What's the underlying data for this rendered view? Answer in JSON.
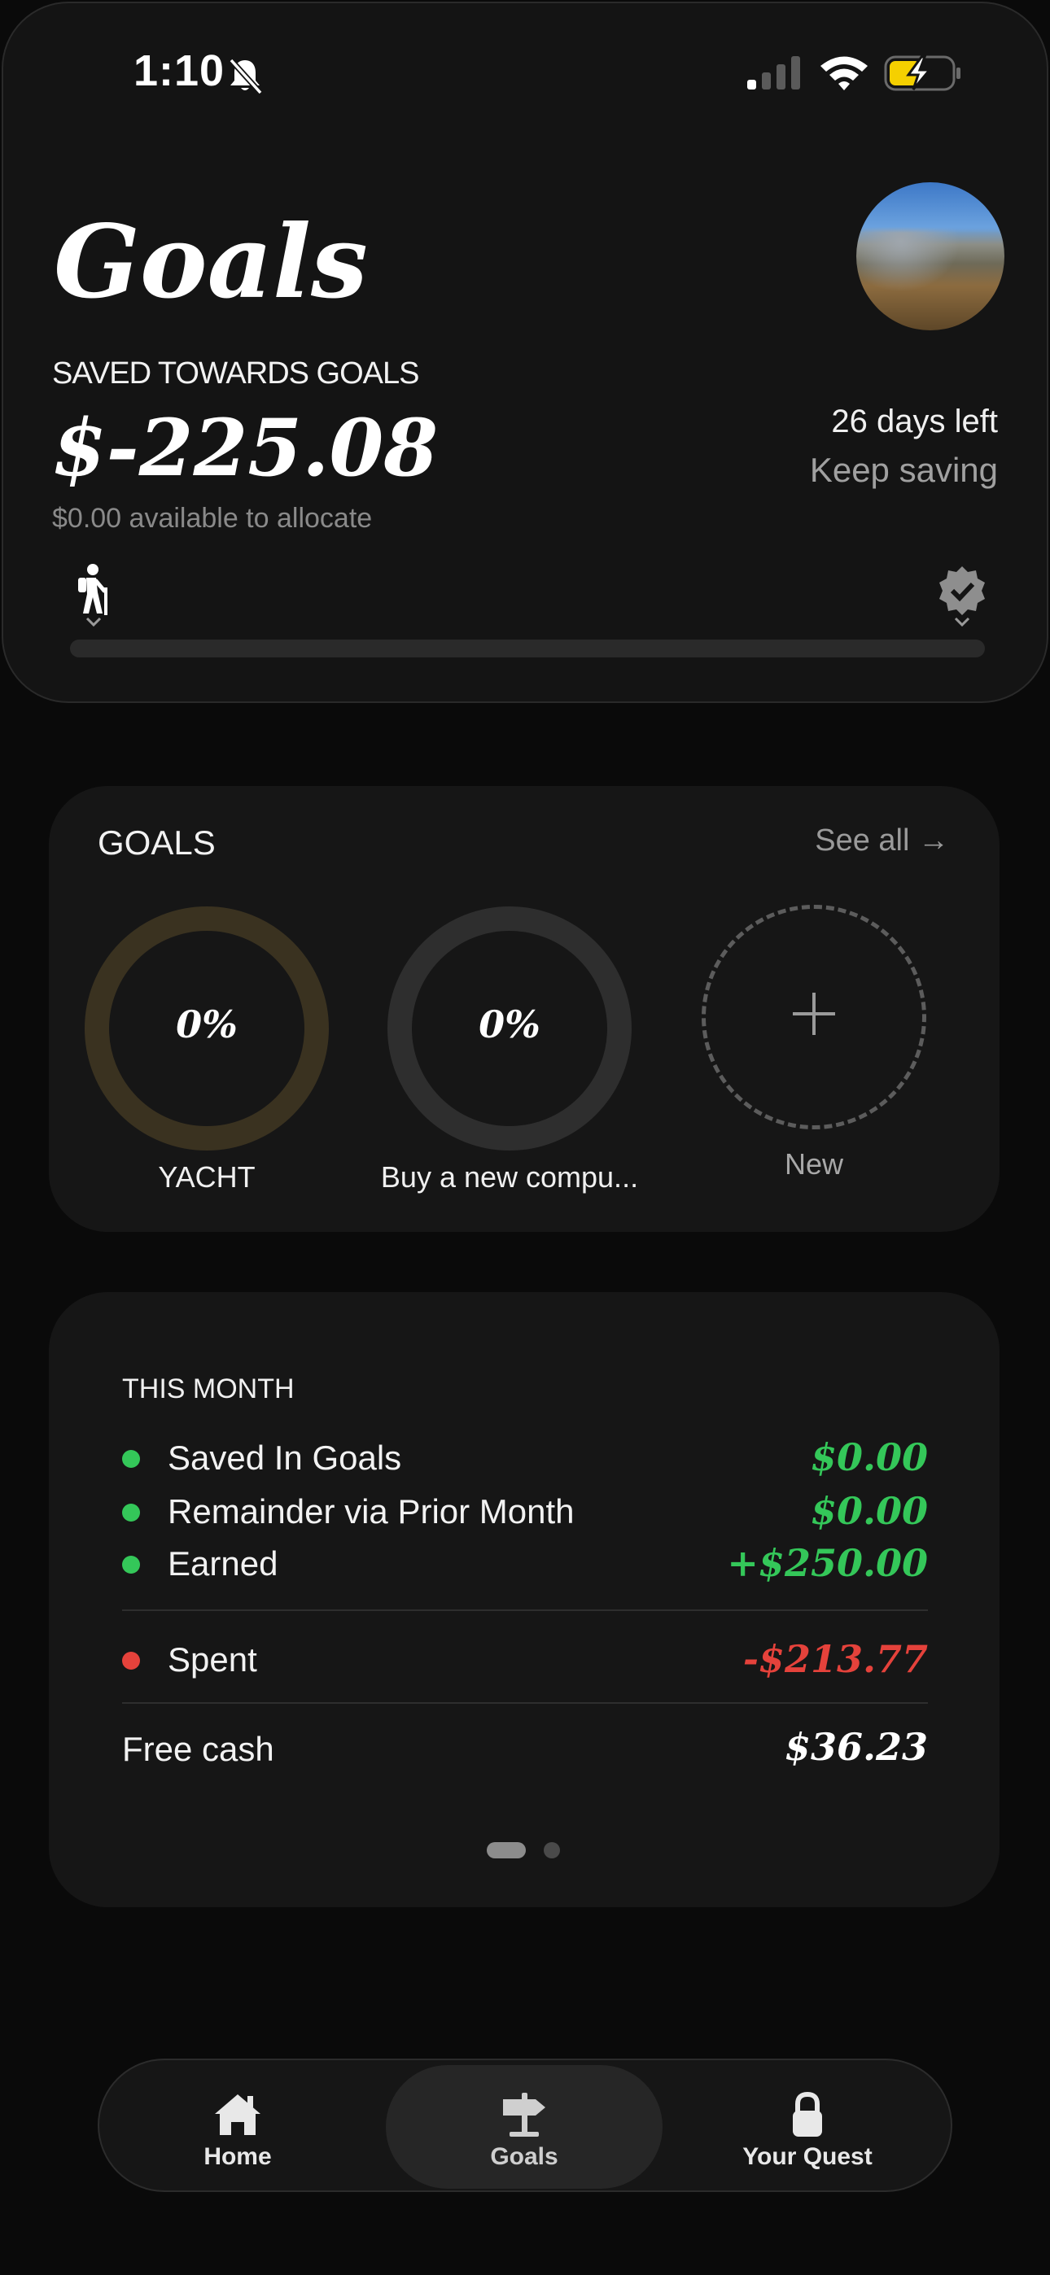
{
  "status_bar": {
    "time": "1:10"
  },
  "header": {
    "title": "Goals",
    "saved_label": "SAVED TOWARDS GOALS",
    "saved_amount": "$-225.08",
    "available_text": "$0.00 available to allocate",
    "days_left": "26 days left",
    "encouragement": "Keep saving",
    "progress_fraction": 0
  },
  "goals_section": {
    "heading": "GOALS",
    "see_all": "See all →",
    "goals": [
      {
        "name": "YACHT",
        "percent": "0%",
        "ring_color": "#3a3220"
      },
      {
        "name": "Buy a new compu...",
        "percent": "0%",
        "ring_color": "#2e2e2e"
      }
    ],
    "new_label": "New"
  },
  "month": {
    "heading": "THIS MONTH",
    "rows": [
      {
        "label": "Saved In Goals",
        "value": "$0.00",
        "color": "#34c759"
      },
      {
        "label": "Remainder via Prior Month",
        "value": "$0.00",
        "color": "#34c759"
      },
      {
        "label": "Earned",
        "value": "+$250.00",
        "color": "#34c759"
      },
      {
        "label": "Spent",
        "value": "-$213.77",
        "color": "#e5423b"
      }
    ],
    "free_cash_label": "Free cash",
    "free_cash_value": "$36.23",
    "page_index": "1 of 2"
  },
  "tab_bar": {
    "tabs": [
      {
        "label": "Home",
        "icon": "house-icon"
      },
      {
        "label": "Goals",
        "icon": "signpost-icon",
        "selected": true
      },
      {
        "label": "Your Quest",
        "icon": "lock-icon"
      }
    ]
  }
}
